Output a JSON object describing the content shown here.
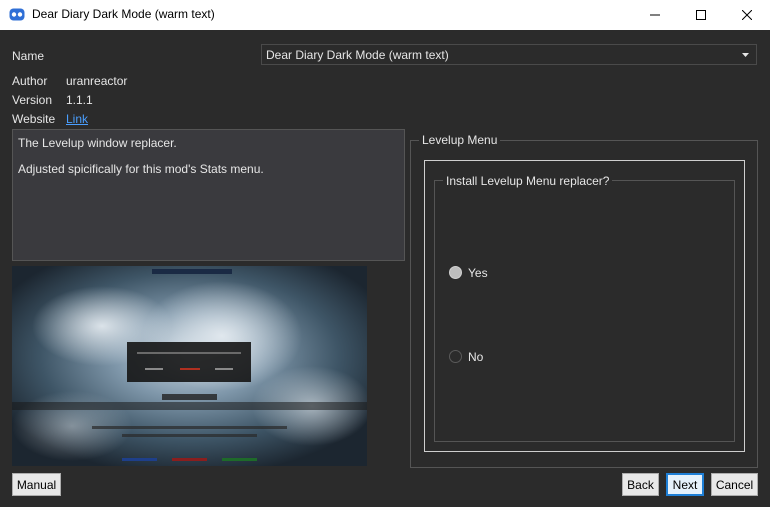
{
  "window": {
    "title": "Dear Diary Dark Mode (warm text)"
  },
  "fields": {
    "name_label": "Name",
    "author_label": "Author",
    "author_value": "uranreactor",
    "version_label": "Version",
    "version_value": "1.1.1",
    "website_label": "Website",
    "website_link": "Link"
  },
  "name_select": {
    "selected": "Dear Diary Dark Mode (warm text)"
  },
  "description": {
    "line1": "The Levelup window replacer.",
    "line2": "Adjusted spicifically for this mod's Stats menu."
  },
  "group": {
    "outer_title": "Levelup Menu",
    "inner_title": "Install Levelup Menu replacer?",
    "options": [
      {
        "label": "Yes",
        "selected": true
      },
      {
        "label": "No",
        "selected": false
      }
    ]
  },
  "buttons": {
    "manual": "Manual",
    "back": "Back",
    "next": "Next",
    "cancel": "Cancel"
  },
  "colors": {
    "background": "#2b2b2b",
    "link": "#4a9fff",
    "default_button_border": "#1e7fd6"
  }
}
